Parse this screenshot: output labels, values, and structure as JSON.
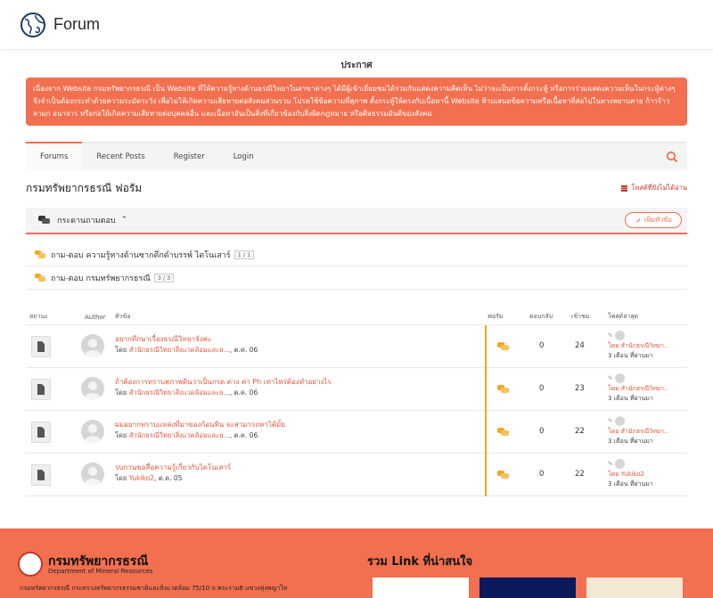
{
  "header": {
    "brand": "Forum"
  },
  "announcement": {
    "title": "ประกาศ",
    "text": "เนื่องจาก Website กรมทรัพยากรธรณี เป็น Website ที่ให้ความรู้ทางด้านธรณีวิทยาในสาขาต่างๆ ได้มีผู้เข้าเยี่ยมชมได้ร่วมกันแสดงความคิดเห็น ไม่ว่าจะเป็นการตั้งกระทู้ หรือการร่วมแสดงความเห็นในกระทู้ต่างๆ จึงจำเป็นต้องกระทำด้วยความระมัดระวัง เพื่อไม่ให้เกิดความเสียหายต่อสังคมส่วนรวม โปรดใช้ข้อความที่สุภาพ ตั้งกระทู้ให้ตรงกับเนื้อหานี้ Website ห้ามเสนอข้อความหรือเนื้อหาที่ส่อไปในทางหยาบคาย ก้าวร้าว ลามก อนาจาร หรือก่อให้เกิดความเสียหายต่อบุคคลอื่น และเนื้อหาอันเป็นสิ่งที่เกี่ยวข้องกับสิ่งผิดกฎหมาย หรือศีลธรรมอันดีของสังคม"
  },
  "nav": {
    "items": [
      "Forums",
      "Recent Posts",
      "Register",
      "Login"
    ]
  },
  "forum": {
    "title": "กรมทรัพยากรธรณี ฟอรัม",
    "unread": "โพสต์ที่ยังไม่ได้อ่าน",
    "board": "กระดานถามตอบ",
    "new_topic": "เพิ่มหัวข้อ"
  },
  "subforums": [
    {
      "name": "ถาม-ตอบ ความรู้ทางด้านซากดึกดำบรรพ์ ไดโนเสาร์",
      "pages": "1 / 1"
    },
    {
      "name": "ถาม-ตอบ กรมทรัพยากรธรณี",
      "pages": "3 / 3"
    }
  ],
  "table_headers": {
    "status": "สถานะ",
    "author": "Author",
    "topic": "หัวข้อ",
    "forum": "ฟอรัม",
    "replies": "ตอบกลับ",
    "views": "เข้าชม",
    "last_post": "โพสต์ล่าสุด"
  },
  "topics": [
    {
      "title": "อยากทึกษาเรื่องธรณีวิทยาจังค่ะ",
      "by": "โดย",
      "author": "สำนักธรณีวิทยาสิ่งแวดล้อมและธ...",
      "date": "ต.ค. 06",
      "replies": "0",
      "views": "24",
      "lp_by": "โดย",
      "lp_author": "สำนักธรณีวิทยา..",
      "lp_time": "3 เดือน ที่ผ่านมา"
    },
    {
      "title": "ถ้าต้องการทราบสภาพดินว่าเป็นกรด ด่าง ค่า Ph เท่าไหร่ต้องทำอย่างไร",
      "by": "โดย",
      "author": "สำนักธรณีวิทยาสิ่งแวดล้อมและธ...",
      "date": "ต.ค. 06",
      "replies": "0",
      "views": "23",
      "lp_by": "โดย",
      "lp_author": "สำนักธรณีวิทยา..",
      "lp_time": "3 เดือน ที่ผ่านมา"
    },
    {
      "title": "ผมอยากทราบแหล่งที่มาของก้อนหิน จะสามารถหาได้มั้ย",
      "by": "โดย",
      "author": "สำนักธรณีวิทยาสิ่งแวดล้อมและธ...",
      "date": "ต.ค. 06",
      "replies": "0",
      "views": "22",
      "lp_by": "โดย",
      "lp_author": "สำนักธรณีวิทยา..",
      "lp_time": "3 เดือน ที่ผ่านมา"
    },
    {
      "title": "รบกวนขอสื่อความรู้เกี่ยวกับไดโนเสาร์",
      "by": "โดย",
      "author": "Yukiko2",
      "date": "ต.ค. 05",
      "replies": "0",
      "views": "22",
      "lp_by": "โดย",
      "lp_author": "Yukiko2",
      "lp_time": "3 เดือน ที่ผ่านมา"
    }
  ],
  "footer": {
    "org_name": "กรมทรัพยากรธรณี",
    "org_en": "Department of Mineral Resources",
    "address": "กรมทรัพยากรธรณี กระทรวงทรัพยากรธรรมชาติและสิ่งแวดล้อม 75/10 ถ.พระราม6 แขวงทุ่งพญาไท",
    "links_title": "รวม Link ที่น่าสนใจ"
  },
  "colors": {
    "accent": "#f26f4f",
    "link": "#e2563a",
    "divider": "#f5a623"
  }
}
